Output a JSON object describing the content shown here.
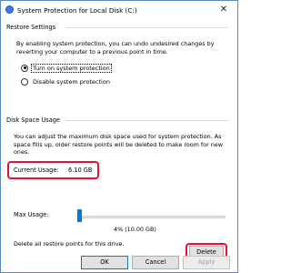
{
  "window": {
    "title": "System Protection for Local Disk (C:)",
    "close_glyph": "✕"
  },
  "restore": {
    "group_label": "Restore Settings",
    "description": "By enabling system protection, you can undo undesired changes by reverting your computer to a previous point in time.",
    "options": [
      {
        "label": "Turn on system protection",
        "selected": true
      },
      {
        "label": "Disable system protection",
        "selected": false
      }
    ]
  },
  "disk": {
    "group_label": "Disk Space Usage",
    "description": "You can adjust the maximum disk space used for system protection. As space fills up, older restore points will be deleted to make room for new ones.",
    "current_usage_label": "Current Usage:",
    "current_usage_value": "6.10 GB",
    "max_usage_label": "Max Usage:",
    "max_usage_value": "4% (10.00 GB)",
    "max_usage_fraction": 0.04,
    "delete_text": "Delete all restore points for this drive.",
    "delete_label": "Delete"
  },
  "footer": {
    "ok_label": "OK",
    "cancel_label": "Cancel",
    "apply_label": "Apply"
  },
  "colors": {
    "accent": "#0078d7",
    "highlight": "#e8112d"
  }
}
